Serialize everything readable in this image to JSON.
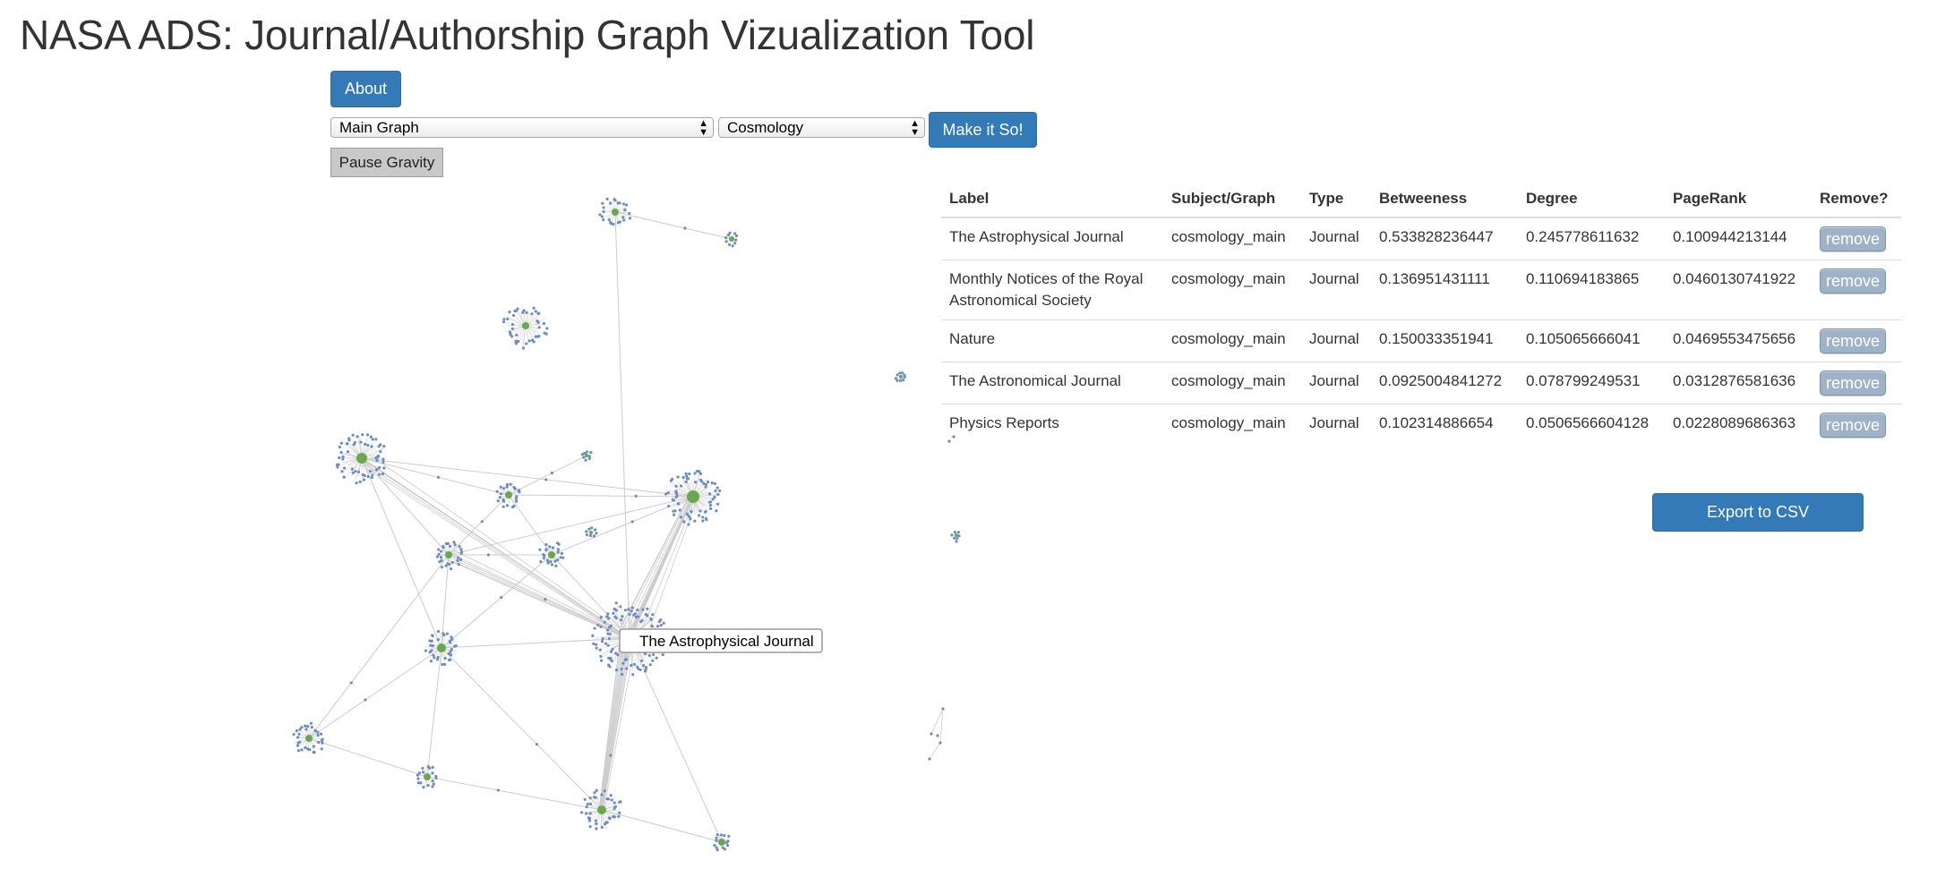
{
  "page": {
    "title": "NASA ADS: Journal/Authorship Graph Vizualization Tool"
  },
  "controls": {
    "about_label": "About",
    "graph_select_value": "Main Graph",
    "subject_select_value": "Cosmology",
    "make_label": "Make it So!",
    "pause_label": "Pause Gravity"
  },
  "graph": {
    "tooltip": "The Astrophysical Journal",
    "colors": {
      "hub": "#6aa84f",
      "leaf": "#6c8ebf",
      "edge": "#cccccc"
    }
  },
  "table": {
    "headers": {
      "label": "Label",
      "subject": "Subject/Graph",
      "type": "Type",
      "betweeness": "Betweeness",
      "degree": "Degree",
      "pagerank": "PageRank",
      "remove": "Remove?"
    },
    "remove_label": "remove",
    "rows": [
      {
        "label": "The Astrophysical Journal",
        "subject": "cosmology_main",
        "type": "Journal",
        "betweeness": "0.533828236447",
        "degree": "0.245778611632",
        "pagerank": "0.100944213144"
      },
      {
        "label": "Monthly Notices of the Royal Astronomical Society",
        "subject": "cosmology_main",
        "type": "Journal",
        "betweeness": "0.136951431111",
        "degree": "0.110694183865",
        "pagerank": "0.0460130741922"
      },
      {
        "label": "Nature",
        "subject": "cosmology_main",
        "type": "Journal",
        "betweeness": "0.150033351941",
        "degree": "0.105065666041",
        "pagerank": "0.0469553475656"
      },
      {
        "label": "The Astronomical Journal",
        "subject": "cosmology_main",
        "type": "Journal",
        "betweeness": "0.0925004841272",
        "degree": "0.078799249531",
        "pagerank": "0.0312876581636"
      },
      {
        "label": "Physics Reports",
        "subject": "cosmology_main",
        "type": "Journal",
        "betweeness": "0.102314886654",
        "degree": "0.0506566604128",
        "pagerank": "0.0228089686363"
      }
    ]
  },
  "export": {
    "label": "Export to CSV"
  }
}
